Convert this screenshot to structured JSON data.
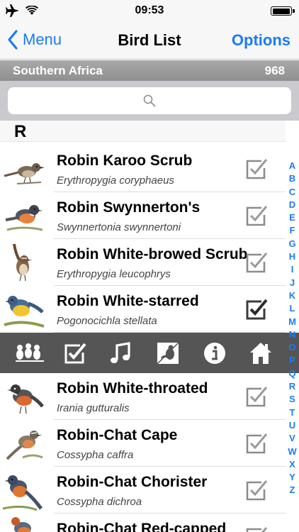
{
  "status_bar": {
    "time": "09:53"
  },
  "nav": {
    "back_label": "Menu",
    "title": "Bird List",
    "options_label": "Options"
  },
  "region": {
    "name": "Southern Africa",
    "count": "968"
  },
  "search": {
    "value": "",
    "placeholder": ""
  },
  "section": {
    "letter": "R"
  },
  "birds": [
    {
      "name": "Robin Karoo Scrub",
      "latin": "Erythropygia coryphaeus",
      "checked": false
    },
    {
      "name": "Robin Swynnerton's",
      "latin": "Swynnertonia swynnertoni",
      "checked": false
    },
    {
      "name": "Robin White-browed Scrub",
      "latin": "Erythropygia leucophrys",
      "checked": false
    },
    {
      "name": "Robin White-starred",
      "latin": "Pogonocichla stellata",
      "checked": true
    },
    {
      "name": "Robin White-throated",
      "latin": "Irania gutturalis",
      "checked": false
    },
    {
      "name": "Robin-Chat Cape",
      "latin": "Cossypha caffra",
      "checked": false
    },
    {
      "name": "Robin-Chat Chorister",
      "latin": "Cossypha dichroa",
      "checked": false
    },
    {
      "name": "Robin-Chat Red-capped",
      "latin": "",
      "checked": false
    }
  ],
  "toolbar": {
    "icons": [
      "birds-flock-icon",
      "checklist-icon",
      "music-note-icon",
      "bird-compare-icon",
      "info-icon",
      "home-icon"
    ]
  },
  "alphabet": [
    "A",
    "B",
    "C",
    "D",
    "E",
    "F",
    "G",
    "H",
    "I",
    "J",
    "K",
    "L",
    "M",
    "N",
    "O",
    "P",
    "Q",
    "R",
    "S",
    "T",
    "U",
    "V",
    "W",
    "X",
    "Y",
    "Z"
  ],
  "colors": {
    "accent": "#1a7cf5",
    "toolbar": "#555555",
    "region_bar": "#9a9a9a"
  }
}
